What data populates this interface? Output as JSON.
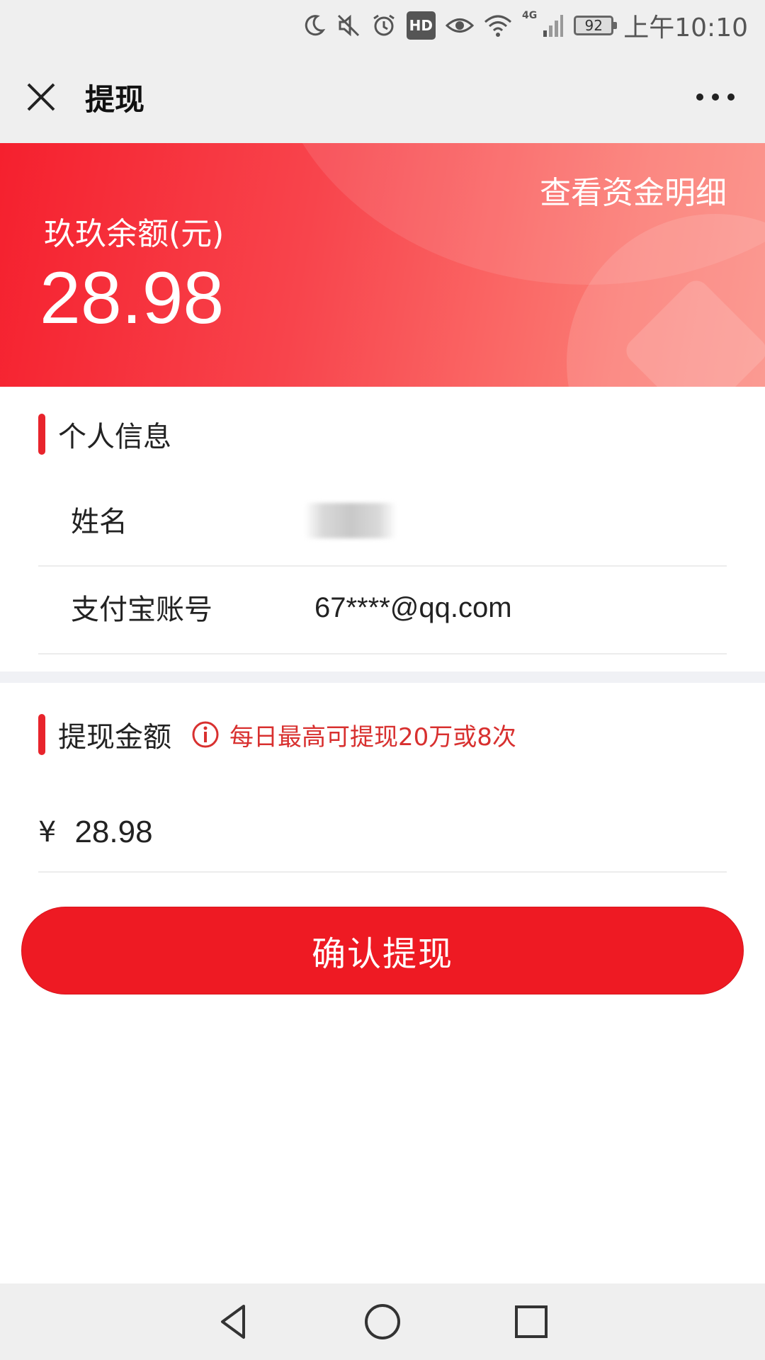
{
  "status_bar": {
    "network": "4G",
    "hd": "HD",
    "battery": "92",
    "time": "上午10:10",
    "icons": [
      "moon-icon",
      "mute-icon",
      "alarm-icon",
      "hd-icon",
      "eye-icon",
      "wifi-icon",
      "signal-icon",
      "battery-icon"
    ]
  },
  "header": {
    "title": "提现"
  },
  "balance_card": {
    "detail_link": "查看资金明细",
    "label": "玖玖余额(元)",
    "amount": "28.98"
  },
  "personal_info": {
    "section_title": "个人信息",
    "rows": [
      {
        "label": "姓名",
        "value": ""
      },
      {
        "label": "支付宝账号",
        "value": "67****@qq.com"
      }
    ]
  },
  "withdraw": {
    "section_title": "提现金额",
    "tip": "每日最高可提现20万或8次",
    "currency": "¥",
    "amount_value": "28.98"
  },
  "confirm_button": "确认提现",
  "colors": {
    "accent": "#ee1a23",
    "tip": "#d8302f",
    "bar_bg": "#efefef"
  }
}
